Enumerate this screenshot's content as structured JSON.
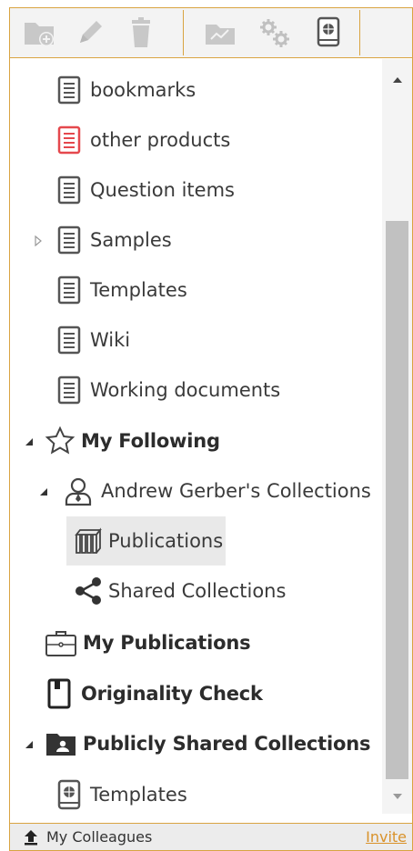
{
  "toolbar": {
    "buttons": [
      {
        "icon": "new-folder-icon"
      },
      {
        "icon": "rename-pencil-icon"
      },
      {
        "icon": "delete-trash-icon"
      },
      {
        "icon": "folder-chart-icon"
      },
      {
        "icon": "settings-gears-icon"
      },
      {
        "icon": "document-globe-icon"
      }
    ]
  },
  "tree": {
    "items": [
      {
        "label": "bookmarks",
        "icon": "document-icon"
      },
      {
        "label": "other products",
        "icon": "document-red-icon",
        "color": "#e5484d"
      },
      {
        "label": "Question items",
        "icon": "document-icon"
      },
      {
        "label": "Samples",
        "icon": "document-icon",
        "expander": "collapsed"
      },
      {
        "label": "Templates",
        "icon": "document-icon"
      },
      {
        "label": "Wiki",
        "icon": "document-icon"
      },
      {
        "label": "Working documents",
        "icon": "document-icon"
      }
    ],
    "my_following": {
      "label": "My Following",
      "icon": "star-icon"
    },
    "andrew": {
      "label": "Andrew Gerber's Collections",
      "icon": "user-icon"
    },
    "publications": {
      "label": "Publications",
      "icon": "books-icon"
    },
    "shared_collections": {
      "label": "Shared Collections",
      "icon": "share-icon"
    },
    "my_publications": {
      "label": "My Publications",
      "icon": "briefcase-icon"
    },
    "originality": {
      "label": "Originality Check",
      "icon": "bookmark-doc-icon"
    },
    "publicly_shared": {
      "label": "Publicly Shared Collections",
      "icon": "user-folder-icon"
    },
    "public_templates": {
      "label": "Templates",
      "icon": "globe-document-icon"
    }
  },
  "footer": {
    "colleagues_label": "My Colleagues",
    "invite_label": "Invite"
  },
  "colors": {
    "accent_border": "#d9a441",
    "invite_link": "#d9922a",
    "selected_bg": "#e9e9e9"
  }
}
